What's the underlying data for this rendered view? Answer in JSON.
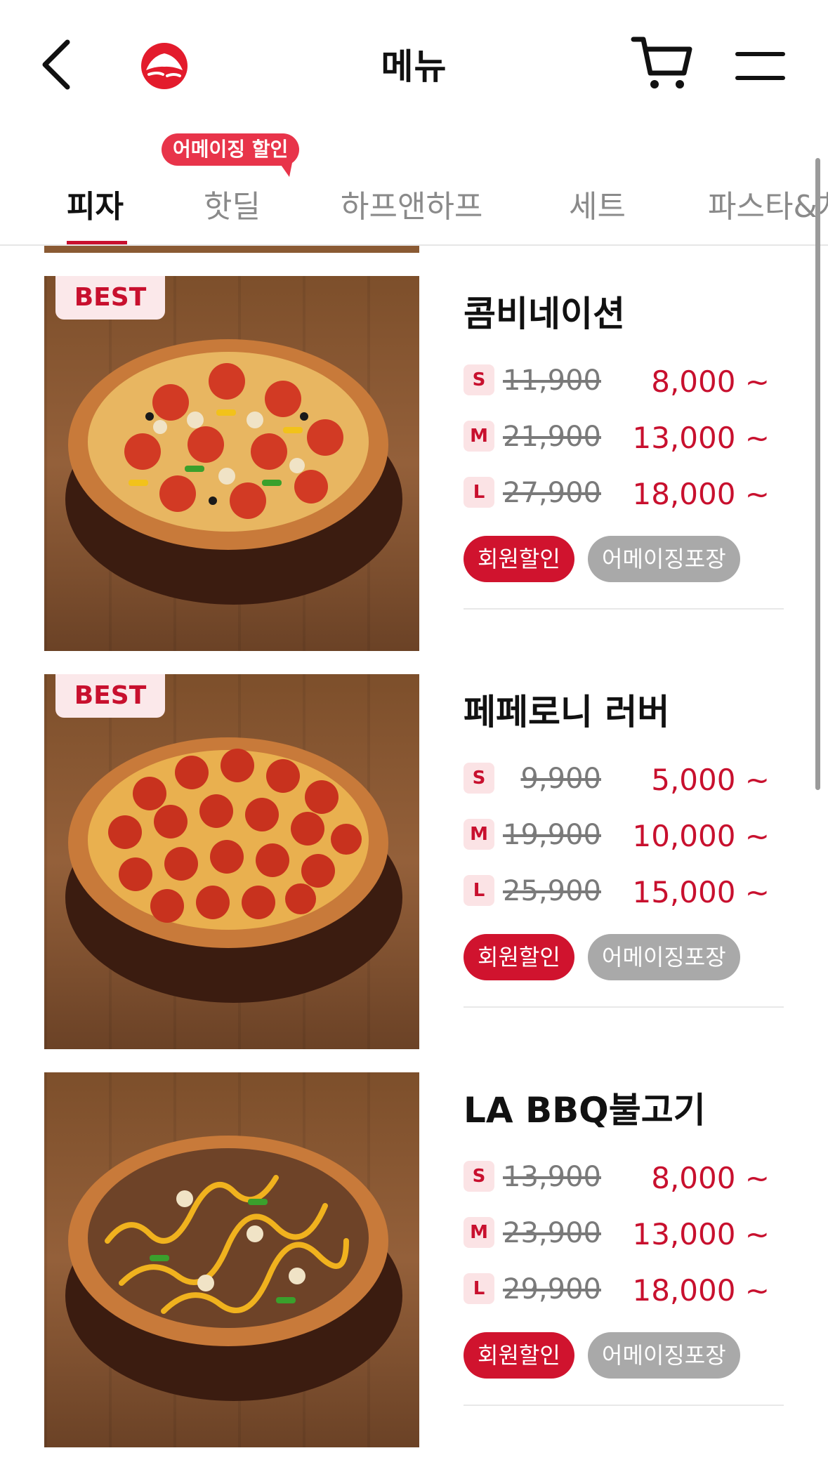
{
  "header": {
    "title": "메뉴"
  },
  "tabs": [
    {
      "label": "피자",
      "active": true
    },
    {
      "label": "핫딜",
      "active": false
    },
    {
      "label": "하프앤하프",
      "active": false
    },
    {
      "label": "세트",
      "active": false
    },
    {
      "label": "파스타&치킨",
      "active": false
    }
  ],
  "promo_badge": "어메이징 할인",
  "colors": {
    "accent": "#c8102e",
    "tag_member": "#d0132e",
    "tag_pack": "#a9a9a9",
    "best_badge_bg": "#fbe8ea"
  },
  "products": [
    {
      "badge": "BEST",
      "name": "콤비네이션",
      "prices": [
        {
          "size": "S",
          "original": "11,900",
          "sale": "8,000 ~"
        },
        {
          "size": "M",
          "original": "21,900",
          "sale": "13,000 ~"
        },
        {
          "size": "L",
          "original": "27,900",
          "sale": "18,000 ~"
        }
      ],
      "tags": [
        "회원할인",
        "어메이징포장"
      ],
      "image": "combination-pizza-image"
    },
    {
      "badge": "BEST",
      "name": "페페로니 러버",
      "prices": [
        {
          "size": "S",
          "original": "9,900",
          "sale": "5,000 ~"
        },
        {
          "size": "M",
          "original": "19,900",
          "sale": "10,000 ~"
        },
        {
          "size": "L",
          "original": "25,900",
          "sale": "15,000 ~"
        }
      ],
      "tags": [
        "회원할인",
        "어메이징포장"
      ],
      "image": "pepperoni-pizza-image"
    },
    {
      "badge": "",
      "name": "LA BBQ불고기",
      "prices": [
        {
          "size": "S",
          "original": "13,900",
          "sale": "8,000 ~"
        },
        {
          "size": "M",
          "original": "23,900",
          "sale": "13,000 ~"
        },
        {
          "size": "L",
          "original": "29,900",
          "sale": "18,000 ~"
        }
      ],
      "tags": [
        "회원할인",
        "어메이징포장"
      ],
      "image": "bbq-bulgogi-pizza-image"
    }
  ]
}
